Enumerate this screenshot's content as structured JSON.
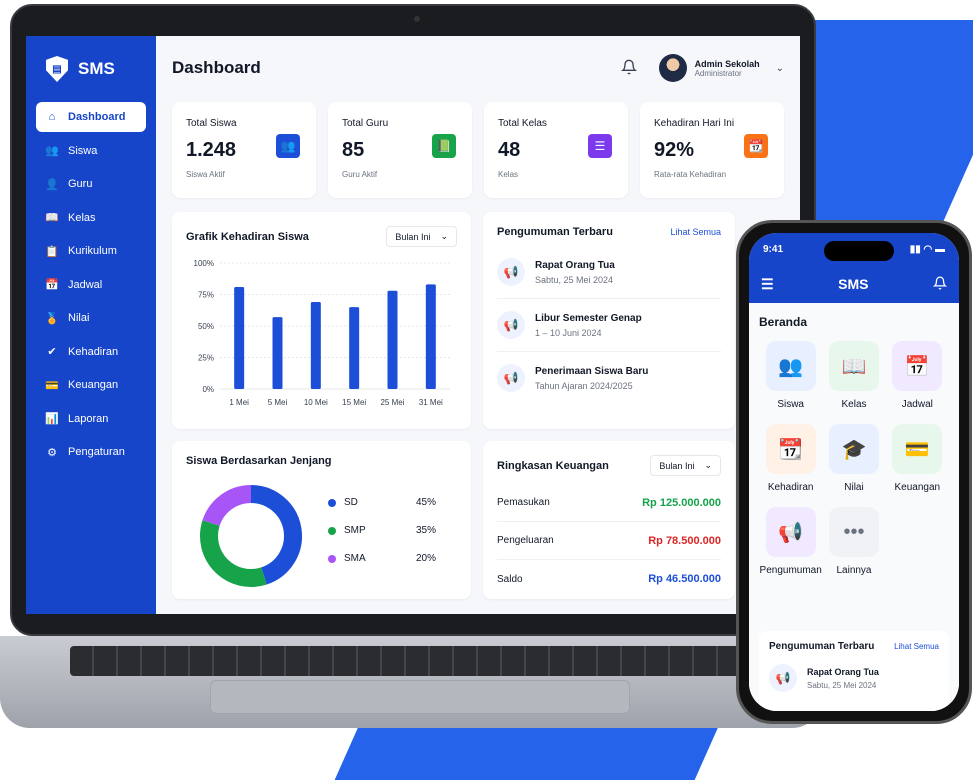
{
  "app": {
    "name": "SMS"
  },
  "sidebar": {
    "items": [
      {
        "label": "Dashboard",
        "icon": "home-icon",
        "active": true
      },
      {
        "label": "Siswa",
        "icon": "users-icon"
      },
      {
        "label": "Guru",
        "icon": "user-icon"
      },
      {
        "label": "Kelas",
        "icon": "book-open-icon"
      },
      {
        "label": "Kurikulum",
        "icon": "clipboard-icon"
      },
      {
        "label": "Jadwal",
        "icon": "calendar-icon"
      },
      {
        "label": "Nilai",
        "icon": "award-icon"
      },
      {
        "label": "Kehadiran",
        "icon": "check-circle-icon"
      },
      {
        "label": "Keuangan",
        "icon": "wallet-icon"
      },
      {
        "label": "Laporan",
        "icon": "bar-chart-icon"
      },
      {
        "label": "Pengaturan",
        "icon": "gear-icon"
      }
    ]
  },
  "header": {
    "title": "Dashboard",
    "user_name": "Admin Sekolah",
    "user_role": "Administrator"
  },
  "stats": [
    {
      "label": "Total Siswa",
      "value": "1.248",
      "sub": "Siswa Aktif",
      "color": "#1d4ed8",
      "icon": "users-icon"
    },
    {
      "label": "Total Guru",
      "value": "85",
      "sub": "Guru Aktif",
      "color": "#16a34a",
      "icon": "book-icon"
    },
    {
      "label": "Total Kelas",
      "value": "48",
      "sub": "Kelas",
      "color": "#7c3aed",
      "icon": "list-icon"
    },
    {
      "label": "Kehadiran Hari Ini",
      "value": "92%",
      "sub": "Rata-rata Kehadiran",
      "color": "#f97316",
      "icon": "calendar-check-icon"
    }
  ],
  "attendance_chart": {
    "title": "Grafik Kehadiran Siswa",
    "period": "Bulan Ini"
  },
  "chart_data": [
    {
      "type": "bar",
      "title": "Grafik Kehadiran Siswa",
      "categories": [
        "1 Mei",
        "5 Mei",
        "10 Mei",
        "15 Mei",
        "25 Mei",
        "31 Mei"
      ],
      "values": [
        81,
        57,
        69,
        65,
        78,
        83
      ],
      "ylim": [
        0,
        100
      ],
      "yticks": [
        "100%",
        "75%",
        "50%",
        "25%",
        "0%"
      ],
      "color": "#1d4ed8",
      "grid": true
    },
    {
      "type": "pie",
      "title": "Siswa Berdasarkan Jenjang",
      "categories": [
        "SD",
        "SMP",
        "SMA"
      ],
      "values": [
        45,
        35,
        20
      ],
      "labels": [
        "45%",
        "35%",
        "20%"
      ],
      "colors": [
        "#1d4ed8",
        "#16a34a",
        "#a855f7"
      ]
    }
  ],
  "announcements": {
    "title": "Pengumuman Terbaru",
    "link": "Lihat Semua",
    "items": [
      {
        "title": "Rapat Orang Tua",
        "date": "Sabtu, 25 Mei 2024"
      },
      {
        "title": "Libur Semester Genap",
        "date": "1 – 10 Juni 2024"
      },
      {
        "title": "Penerimaan Siswa Baru",
        "date": "Tahun Ajaran 2024/2025"
      }
    ]
  },
  "levels": {
    "title": "Siswa Berdasarkan Jenjang"
  },
  "finance": {
    "title": "Ringkasan Keuangan",
    "period": "Bulan Ini",
    "rows": [
      {
        "label": "Pemasukan",
        "amount": "Rp 125.000.000",
        "color": "#16a34a"
      },
      {
        "label": "Pengeluaran",
        "amount": "Rp 78.500.000",
        "color": "#dc2626"
      },
      {
        "label": "Saldo",
        "amount": "Rp 46.500.000",
        "color": "#1d4ed8"
      }
    ]
  },
  "phone": {
    "time": "9:41",
    "title": "SMS",
    "section": "Beranda",
    "tiles": [
      {
        "label": "Siswa",
        "icon": "users-icon",
        "color": "#1d4ed8",
        "bg": "#e8efff"
      },
      {
        "label": "Kelas",
        "icon": "book-open-icon",
        "color": "#16a34a",
        "bg": "#e7f7ec"
      },
      {
        "label": "Jadwal",
        "icon": "calendar-icon",
        "color": "#7c3aed",
        "bg": "#f1e9ff"
      },
      {
        "label": "Kehadiran",
        "icon": "calendar-check-icon",
        "color": "#f97316",
        "bg": "#fff1e6"
      },
      {
        "label": "Nilai",
        "icon": "graduation-cap-icon",
        "color": "#1d4ed8",
        "bg": "#e8efff"
      },
      {
        "label": "Keuangan",
        "icon": "wallet-icon",
        "color": "#16a34a",
        "bg": "#e7f7ec"
      },
      {
        "label": "Pengumuman",
        "icon": "megaphone-icon",
        "color": "#7c3aed",
        "bg": "#f1e9ff"
      },
      {
        "label": "Lainnya",
        "icon": "more-icon",
        "color": "#6b7280",
        "bg": "#f1f2f5"
      }
    ],
    "announcement_title": "Pengumuman Terbaru",
    "announcement_link": "Lihat Semua",
    "announcement_item": {
      "title": "Rapat Orang Tua",
      "date": "Sabtu, 25 Mei 2024"
    }
  }
}
